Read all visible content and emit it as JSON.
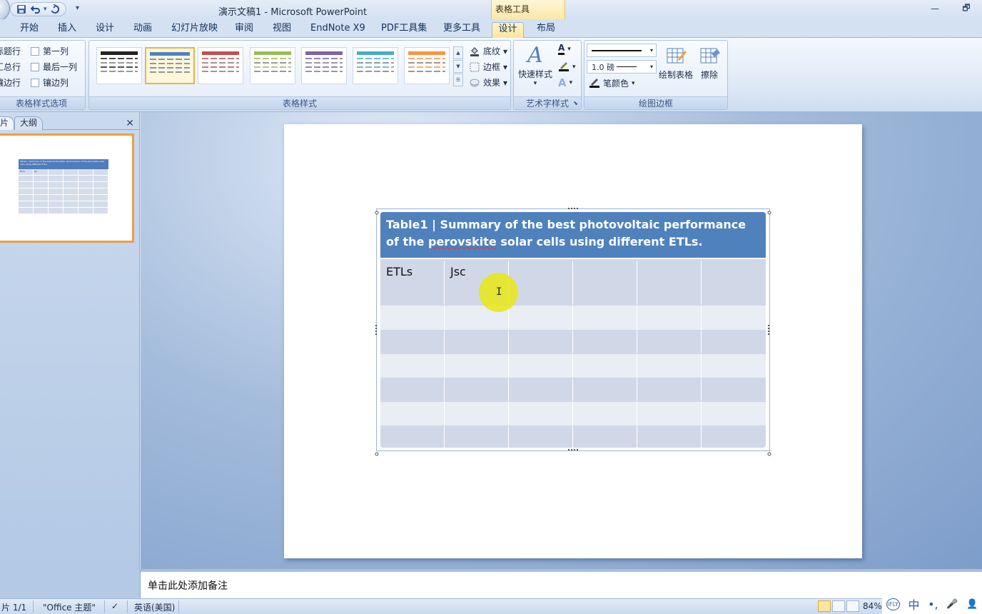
{
  "window": {
    "title": "演示文稿1 - Microsoft PowerPoint",
    "context_group": "表格工具",
    "restore_glyph": "🗗",
    "minimize_glyph": "—"
  },
  "tabs": [
    "开始",
    "插入",
    "设计",
    "动画",
    "幻灯片放映",
    "审阅",
    "视图",
    "EndNote X9",
    "PDF工具集",
    "更多工具",
    "设计",
    "布局"
  ],
  "ribbon": {
    "table_style_options": {
      "label": "表格样式选项",
      "items": [
        "标题行",
        "汇总行",
        "镶边行",
        "第一列",
        "最后一列",
        "镶边列"
      ]
    },
    "table_styles": {
      "label": "表格样式",
      "thumb_colors": [
        "#222222",
        "#4f81bd",
        "#c0504d",
        "#9bbb59",
        "#8064a2",
        "#4bacc6",
        "#f79646"
      ],
      "shading": "底纹",
      "border": "边框",
      "effects": "效果"
    },
    "wordart": {
      "label": "艺术字样式",
      "quick_styles": "快速样式"
    },
    "draw_borders": {
      "label": "绘图边框",
      "pen_weight": "1.0 磅",
      "pen_color": "笔颜色",
      "draw_table": "绘制表格",
      "eraser": "擦除"
    }
  },
  "left_panel": {
    "tab_slides": "片",
    "tab_outline": "大纲",
    "close": "✕",
    "thumb_title": "Table1 | Summary of the best photovoltaic performance of the perovskite solar cells using different ETLs.",
    "thumb_c1": "ETLs",
    "thumb_c2": "Jsc"
  },
  "slide": {
    "table_title_part1": "Table1 | Summary of the best photovoltaic performance of the ",
    "table_title_misspelled": "perovskite",
    "table_title_part2": " solar cells using different ETLs.",
    "header_row": [
      "ETLs",
      "Jsc",
      "",
      "",
      "",
      ""
    ]
  },
  "notes": {
    "placeholder": "单击此处添加备注"
  },
  "status": {
    "slide_info": "片 1/1",
    "theme": "\"Office 主题\"",
    "language": "英语(美国)",
    "zoom": "84%"
  },
  "tray": {
    "ifly": "iFLY",
    "ime": "中",
    "punct": "•,",
    "mic": "🎤",
    "user": "👤"
  }
}
